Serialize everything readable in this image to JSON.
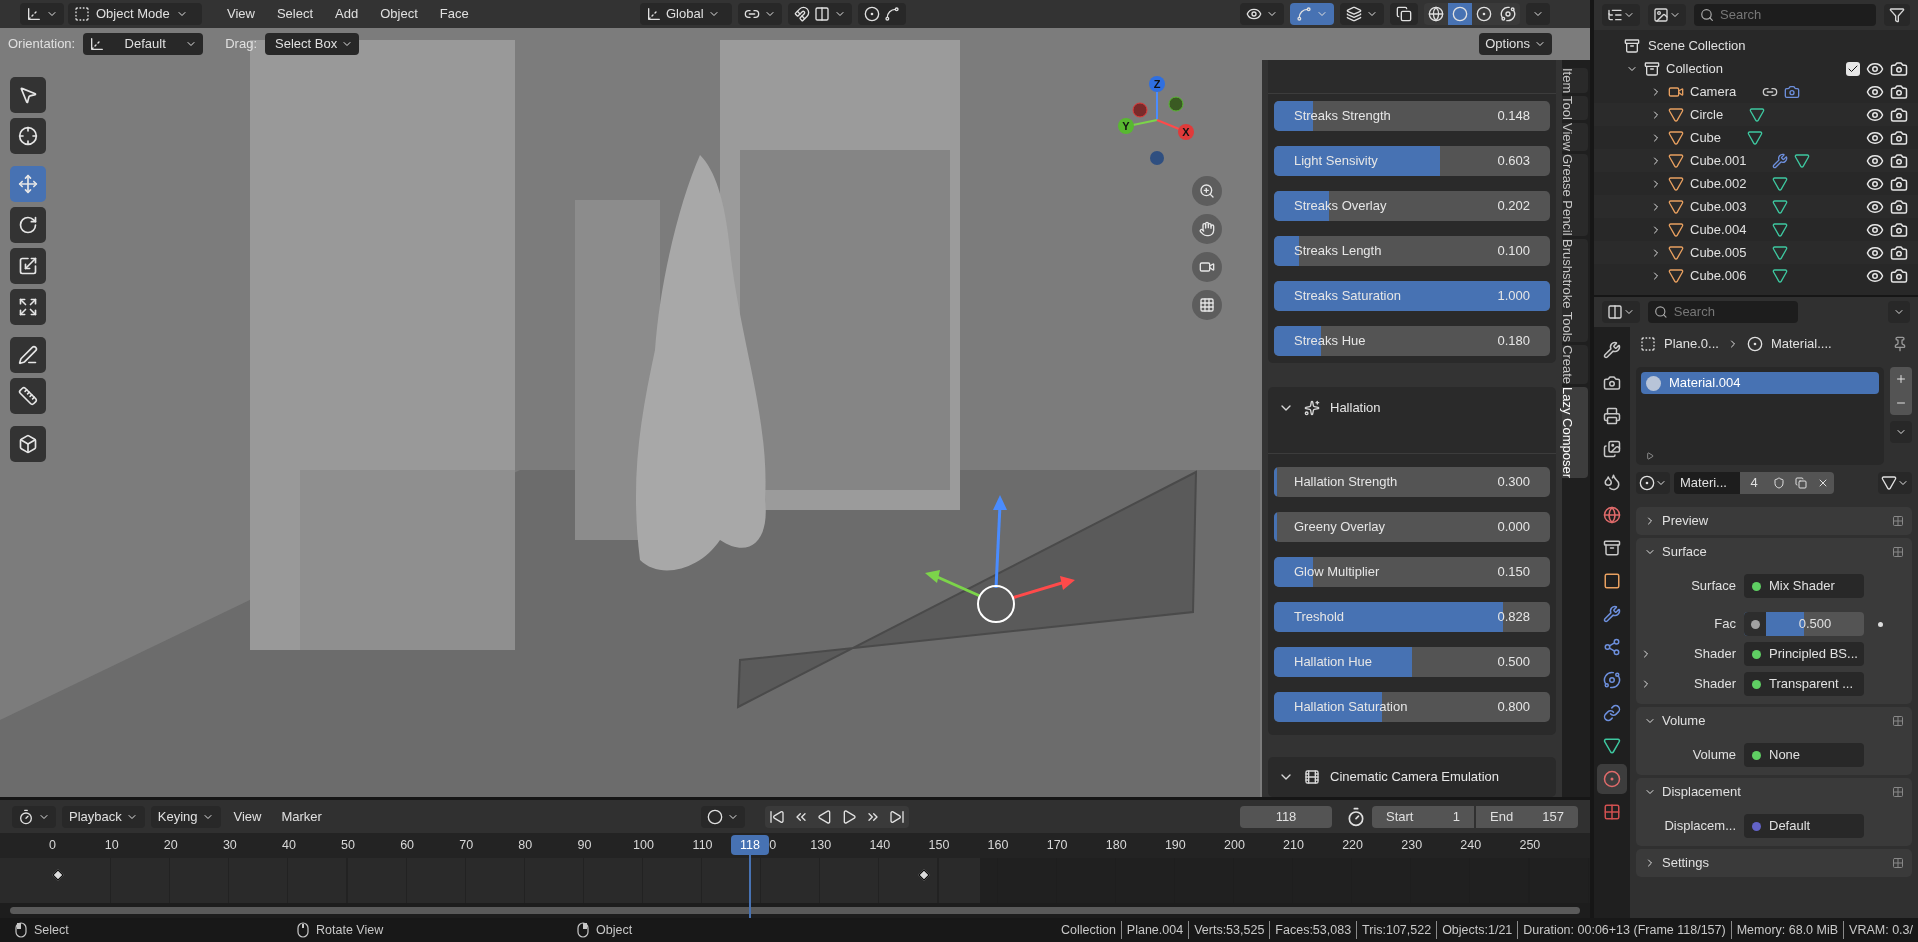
{
  "header": {
    "mode": "Object Mode",
    "menus": [
      "View",
      "Select",
      "Add",
      "Object",
      "Face"
    ],
    "orientation": "Global",
    "gizmos": {
      "on": true
    },
    "shading": [
      {
        "kind": "wireframe",
        "selected": false
      },
      {
        "kind": "solid",
        "selected": true
      },
      {
        "kind": "material",
        "selected": false
      },
      {
        "kind": "rendered",
        "selected": false
      }
    ]
  },
  "tool_settings": {
    "orientation_label": "Orientation:",
    "orientation": "Default",
    "drag_label": "Drag:",
    "drag": "Select Box",
    "options": "Options"
  },
  "toolbar": [
    {
      "kind": "select",
      "selected": false
    },
    {
      "kind": "cursor",
      "selected": false
    },
    {
      "kind": "move",
      "selected": true
    },
    {
      "kind": "rotate",
      "selected": false
    },
    {
      "kind": "scale",
      "selected": false
    },
    {
      "kind": "transform",
      "selected": false
    },
    {
      "kind": "annotate",
      "selected": false
    },
    {
      "kind": "measure",
      "selected": false
    },
    {
      "kind": "add_cube",
      "selected": false
    }
  ],
  "view_axes": [
    "Z",
    "Y",
    "X"
  ],
  "sidebar": {
    "sliders": [
      {
        "label": "Streaks Strength",
        "reading": "0.148",
        "level": 0.14
      },
      {
        "label": "Light Sensivity",
        "reading": "0.603",
        "level": 0.6
      },
      {
        "label": "Streaks Overlay",
        "reading": "0.202",
        "level": 0.2
      },
      {
        "label": "Streaks Length",
        "reading": "0.100",
        "level": 0.09
      },
      {
        "label": "Streaks Saturation",
        "reading": "1.000",
        "level": 1
      },
      {
        "label": "Streaks Hue",
        "reading": "0.180",
        "level": 0.17
      }
    ],
    "sections": [
      {
        "title": "Hallation",
        "kind": "hallation",
        "expanded": true,
        "sliders": [
          {
            "label": "Hallation Strength",
            "reading": "0.300",
            "level": 0
          },
          {
            "label": "Greeny Overlay",
            "reading": "0.000",
            "level": 0
          },
          {
            "label": "Glow Multiplier",
            "reading": "0.150",
            "level": 0.14
          },
          {
            "label": "Treshold",
            "reading": "0.828",
            "level": 0.83
          },
          {
            "label": "Hallation Hue",
            "reading": "0.500",
            "level": 0.5
          },
          {
            "label": "Hallation Saturation",
            "reading": "0.800",
            "level": 0.39
          }
        ]
      },
      {
        "title": "Cinematic Camera Emulation",
        "kind": "camera",
        "expanded": true
      }
    ],
    "tabs": [
      {
        "label": "Item",
        "selected": false
      },
      {
        "label": "Tool",
        "selected": false
      },
      {
        "label": "View",
        "selected": false
      },
      {
        "label": "Grease Pencil",
        "selected": false
      },
      {
        "label": "Brushstroke Tools",
        "selected": false
      },
      {
        "label": "Create",
        "selected": false
      },
      {
        "label": "Lazy Composer",
        "selected": true
      }
    ]
  },
  "outliner": {
    "search": {
      "placeholder": "Search"
    },
    "scene": "Scene Collection",
    "collection": {
      "name": "Collection",
      "expanded": true,
      "checked": true,
      "children": [
        {
          "name": "Camera",
          "kind": "camera",
          "expanded": false,
          "modifier": false
        },
        {
          "name": "Circle",
          "kind": "mesh",
          "expanded": false,
          "modifier": false
        },
        {
          "name": "Cube",
          "kind": "mesh",
          "expanded": false,
          "modifier": false
        },
        {
          "name": "Cube.001",
          "kind": "mesh",
          "expanded": false,
          "modifier": true
        },
        {
          "name": "Cube.002",
          "kind": "mesh",
          "expanded": false,
          "modifier": false
        },
        {
          "name": "Cube.003",
          "kind": "mesh",
          "expanded": false,
          "modifier": false
        },
        {
          "name": "Cube.004",
          "kind": "mesh",
          "expanded": false,
          "modifier": false
        },
        {
          "name": "Cube.005",
          "kind": "mesh",
          "expanded": false,
          "modifier": false
        },
        {
          "name": "Cube.006",
          "kind": "mesh",
          "expanded": false,
          "modifier": false
        }
      ]
    }
  },
  "properties": {
    "search": {
      "placeholder": "Search"
    },
    "tabs": [
      {
        "kind": "tool",
        "selected": false
      },
      {
        "kind": "render",
        "selected": false
      },
      {
        "kind": "output",
        "selected": false
      },
      {
        "kind": "view_layer",
        "selected": false
      },
      {
        "kind": "scene",
        "selected": false
      },
      {
        "kind": "world",
        "selected": false
      },
      {
        "kind": "collection",
        "selected": false
      },
      {
        "kind": "object",
        "selected": false
      },
      {
        "kind": "modifiers",
        "selected": false
      },
      {
        "kind": "particles",
        "selected": false
      },
      {
        "kind": "physics",
        "selected": false
      },
      {
        "kind": "constraints",
        "selected": false
      },
      {
        "kind": "data",
        "selected": false
      },
      {
        "kind": "material",
        "selected": true
      },
      {
        "kind": "texture",
        "selected": false
      }
    ],
    "breadcrumb": [
      "Plane.0...",
      "Material...."
    ],
    "slots": [
      {
        "name": "Material.004",
        "selected": true
      }
    ],
    "material": {
      "name": "Materi...",
      "users": "4"
    },
    "panels": [
      {
        "title": "Preview",
        "expanded": false
      },
      {
        "title": "Surface",
        "expanded": true,
        "rows": [
          {
            "kind": "socket",
            "label": "Surface",
            "value": "Mix Shader",
            "color": "#5fcf63"
          },
          {
            "kind": "slider",
            "label": "Fac",
            "reading": "0.500",
            "level": 0.5,
            "color": "#a1a1a1"
          },
          {
            "kind": "socket",
            "label": "Shader",
            "value": "Principled BS...",
            "color": "#5fcf63",
            "expanded": false
          },
          {
            "kind": "socket",
            "label": "Shader",
            "value": "Transparent ...",
            "color": "#5fcf63",
            "expanded": false
          }
        ]
      },
      {
        "title": "Volume",
        "expanded": true,
        "rows": [
          {
            "kind": "socket",
            "label": "Volume",
            "value": "None",
            "color": "#5fcf63"
          }
        ]
      },
      {
        "title": "Displacement",
        "expanded": true,
        "rows": [
          {
            "kind": "socket",
            "label": "Displacem...",
            "value": "Default",
            "color": "#6363c7"
          }
        ]
      },
      {
        "title": "Settings",
        "expanded": false
      }
    ]
  },
  "timeline": {
    "menus": [
      {
        "label": "Playback",
        "dropdown": true
      },
      {
        "label": "Keying",
        "dropdown": true
      },
      {
        "label": "View",
        "dropdown": false
      },
      {
        "label": "Marker",
        "dropdown": false
      }
    ],
    "current_frame": "118",
    "start_label": "Start",
    "start": "1",
    "end_label": "End",
    "end": "157",
    "playhead": "118",
    "ruler": [
      {
        "label": "0",
        "partial": false
      },
      {
        "label": "10",
        "partial": false
      },
      {
        "label": "20",
        "partial": false
      },
      {
        "label": "30",
        "partial": false
      },
      {
        "label": "40",
        "partial": false
      },
      {
        "label": "50",
        "partial": false
      },
      {
        "label": "60",
        "partial": false
      },
      {
        "label": "70",
        "partial": false
      },
      {
        "label": "80",
        "partial": false
      },
      {
        "label": "90",
        "partial": false
      },
      {
        "label": "100",
        "partial": false
      },
      {
        "label": "110",
        "partial": false
      },
      {
        "label": "0",
        "partial": true
      },
      {
        "label": "130",
        "partial": false
      },
      {
        "label": "140",
        "partial": false
      },
      {
        "label": "150",
        "partial": false
      },
      {
        "label": "160",
        "partial": false
      },
      {
        "label": "170",
        "partial": false
      },
      {
        "label": "180",
        "partial": false
      },
      {
        "label": "190",
        "partial": false
      },
      {
        "label": "200",
        "partial": false
      },
      {
        "label": "210",
        "partial": false
      },
      {
        "label": "220",
        "partial": false
      },
      {
        "label": "230",
        "partial": false
      },
      {
        "label": "240",
        "partial": false
      },
      {
        "label": "250",
        "partial": false
      }
    ]
  },
  "status_bar": {
    "hints": [
      {
        "kind": "left",
        "label": "Select"
      },
      {
        "kind": "middle",
        "label": "Rotate View"
      },
      {
        "kind": "right",
        "label": "Object"
      }
    ],
    "stats": [
      "Collection",
      "Plane.004",
      "Verts:53,525",
      "Faces:53,083",
      "Tris:107,522",
      "Objects:1/21",
      "Duration: 00:06+13 (Frame 118/157)",
      "Memory: 68.0 MiB",
      "VRAM: 0.3/"
    ]
  }
}
